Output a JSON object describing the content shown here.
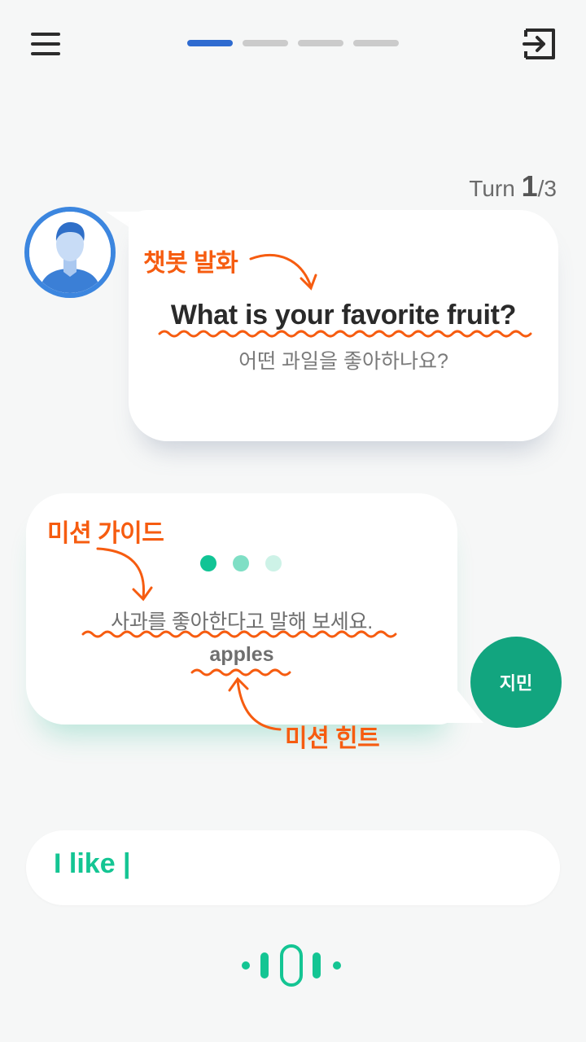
{
  "header": {
    "menu_icon": "hamburger-menu-icon",
    "progress": {
      "total_steps": 4,
      "current_step": 1,
      "active_color": "#2f6bd0",
      "inactive_color": "#cbcbcb"
    },
    "exit_icon": "exit-icon"
  },
  "turn": {
    "label": "Turn",
    "current": "1",
    "total": "/3"
  },
  "bot": {
    "avatar_icon": "person-avatar-icon",
    "question": "What is your favorite fruit?",
    "translation": "어떤 과일을 좋아하나요?"
  },
  "mission": {
    "dots": [
      "#11c495",
      "#7fdfc5",
      "#cdf2e7"
    ],
    "guide": "사과를 좋아한다고 말해 보세요.",
    "hint": "apples"
  },
  "user": {
    "name": "지민",
    "avatar_color": "#12a57f"
  },
  "annotations": {
    "bot_utterance": "챗봇 발화",
    "mission_guide": "미션 가이드",
    "mission_hint": "미션 힌트",
    "color": "#f65c10"
  },
  "input": {
    "value": "I like |"
  },
  "mic_icon": "voice-wave-mic-icon"
}
